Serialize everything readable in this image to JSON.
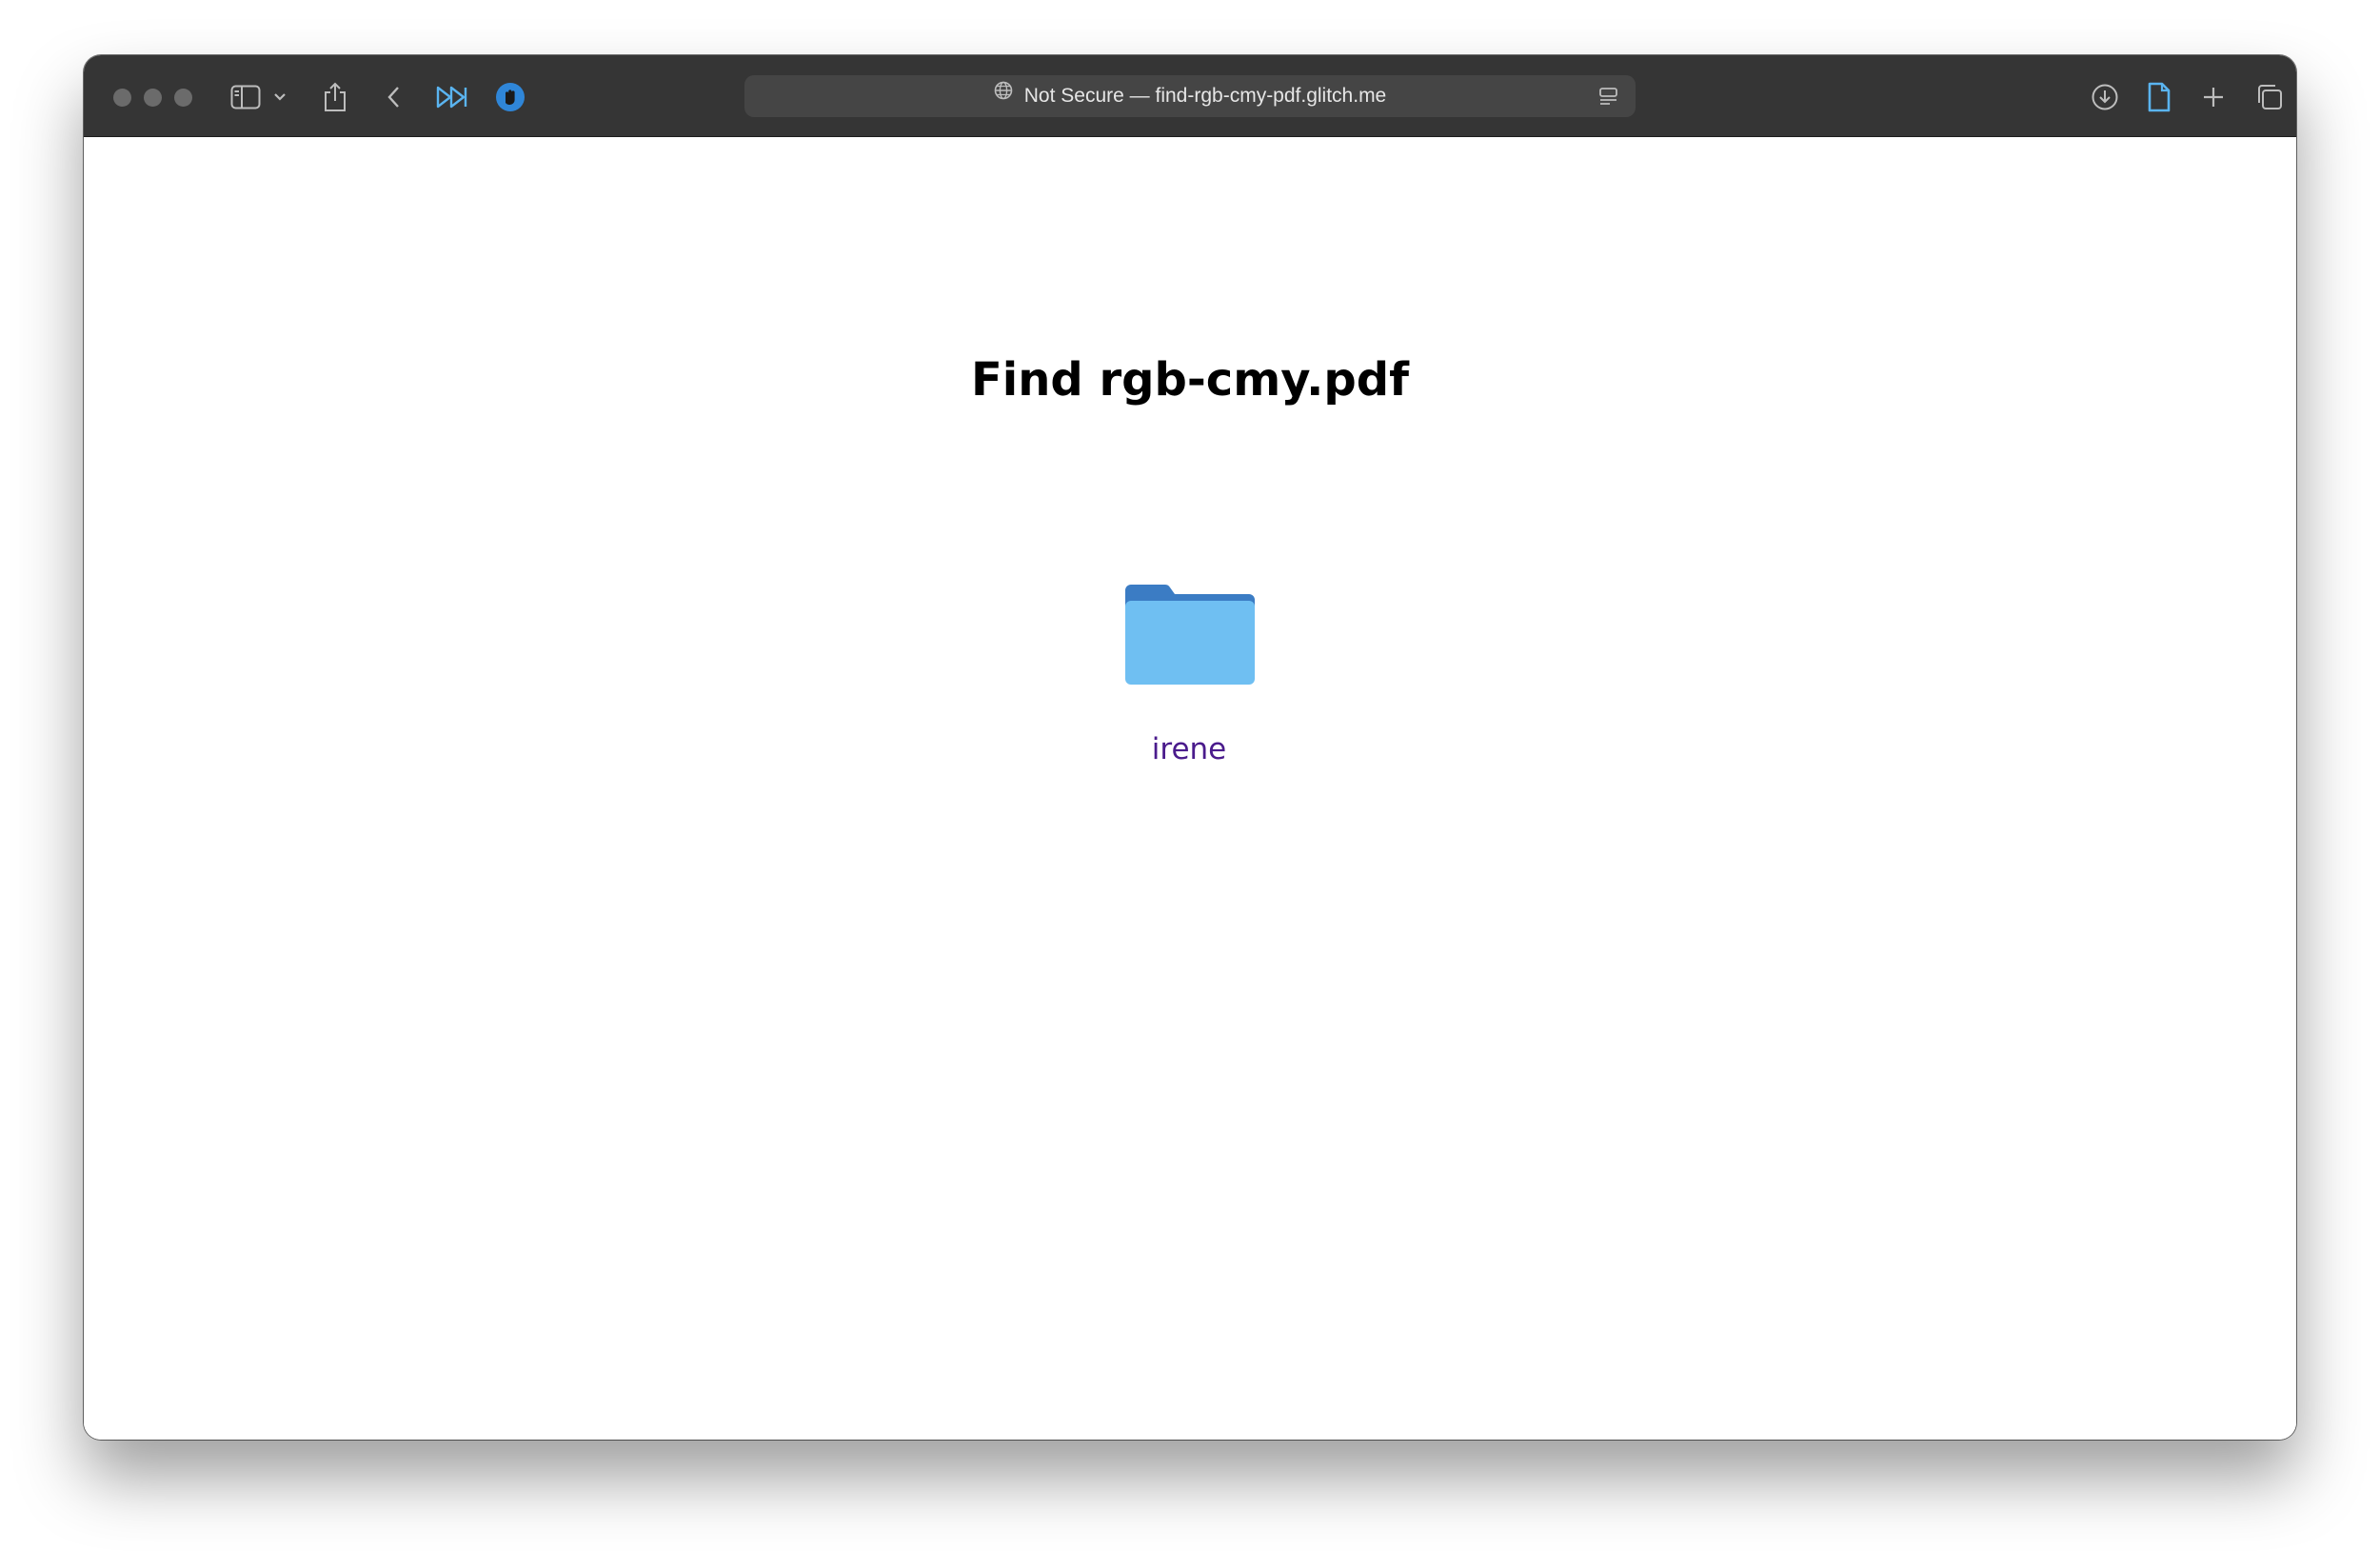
{
  "browser": {
    "address_bar": {
      "security_label": "Not Secure",
      "separator": "—",
      "domain": "find-rgb-cmy-pdf.glitch.me"
    },
    "toolbar_icons": [
      "sidebar-icon",
      "chevron-down-icon",
      "share-icon",
      "back-icon",
      "fast-forward-icon",
      "hand-extension-icon",
      "download-icon",
      "page-icon",
      "plus-icon",
      "tabs-icon"
    ],
    "colors": {
      "toolbar": "#353535",
      "address_bar": "#454545",
      "accent": "#5ab4f0"
    }
  },
  "page": {
    "title": "Find rgb-cmy.pdf",
    "folder": {
      "label": "irene",
      "icon": "folder-icon",
      "link_color": "#4a1b8c",
      "folder_color": "#6fbff2",
      "folder_tab_color": "#3b7cc4"
    }
  }
}
